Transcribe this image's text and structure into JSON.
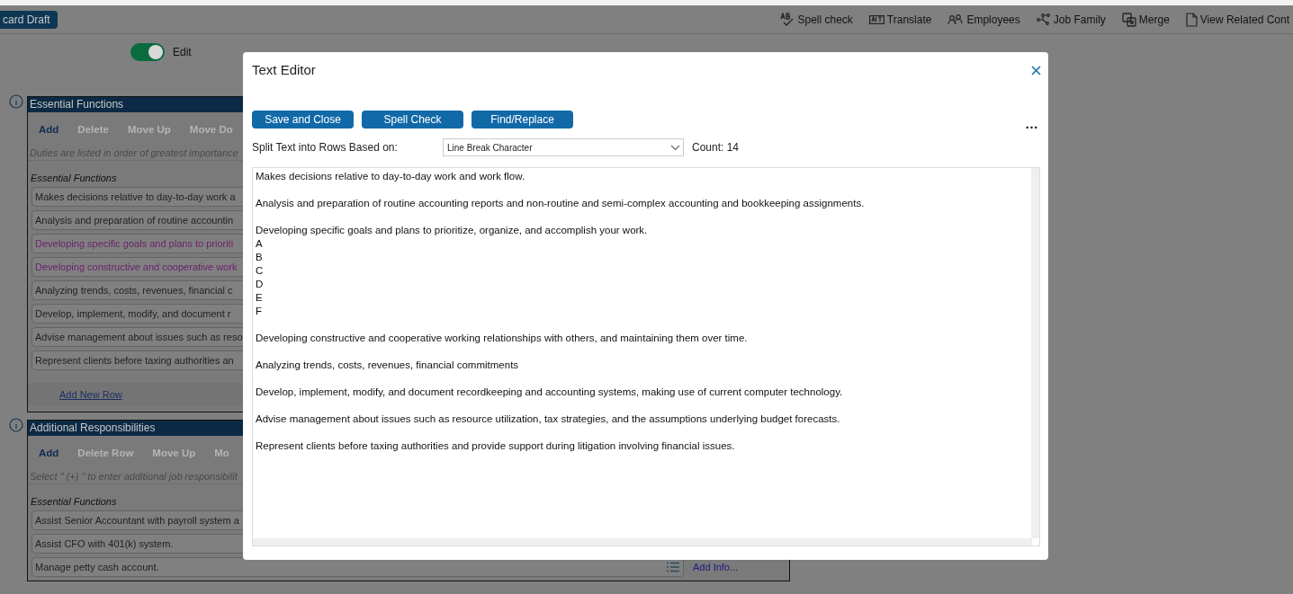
{
  "header": {
    "draft_button": "card Draft",
    "toolbar": [
      {
        "kind": "spell",
        "label": "Spell check"
      },
      {
        "kind": "translate",
        "label": "Translate"
      },
      {
        "kind": "employees",
        "label": "Employees"
      },
      {
        "kind": "family",
        "label": "Job Family"
      },
      {
        "kind": "merge",
        "label": "Merge"
      },
      {
        "kind": "document",
        "label": "View Related Cont"
      }
    ]
  },
  "edit_toggle": {
    "label": "Edit",
    "on": true
  },
  "sections": [
    {
      "title": "Essential Functions",
      "actions": [
        {
          "label": "Add",
          "disabled": false
        },
        {
          "label": "Delete",
          "disabled": true
        },
        {
          "label": "Move Up",
          "disabled": true
        },
        {
          "label": "Move Do",
          "disabled": true
        }
      ],
      "hint": "Duties are listed in order of greatest importance",
      "list_label": "Essential Functions",
      "rows": [
        {
          "text": "Makes decisions relative to day-to-day work a",
          "color": "#1f1f1f"
        },
        {
          "text": "Analysis and preparation of routine accountin",
          "color": "#1f1f1f"
        },
        {
          "text": "Developing specific goals and plans to prioriti",
          "color": "#6b1f6b"
        },
        {
          "text": "Developing constructive and cooperative work",
          "color": "#6b1f6b"
        },
        {
          "text": "Analyzing trends, costs, revenues, financial c",
          "color": "#1f1f1f"
        },
        {
          "text": "Develop, implement, modify, and document r",
          "color": "#1f1f1f"
        },
        {
          "text": "Advise management about issues such as reso",
          "color": "#1f1f1f"
        },
        {
          "text": "Represent clients before taxing authorities an",
          "color": "#1f1f1f"
        }
      ],
      "footer_link": "Add New Row"
    },
    {
      "title": "Additional Responsibilities",
      "actions": [
        {
          "label": "Add",
          "disabled": false
        },
        {
          "label": "Delete Row",
          "disabled": true
        },
        {
          "label": "Move Up",
          "disabled": true
        },
        {
          "label": "Mo",
          "disabled": true
        }
      ],
      "hint": "Select \" (+) \" to enter additional job responsibilit",
      "list_label": "Essential Functions",
      "rows": [
        {
          "text": "Assist Senior Accountant with payroll system a",
          "color": "#1f1f1f"
        },
        {
          "text": "Assist CFO with 401(k) system.",
          "color": "#1f1f1f"
        },
        {
          "text": "Manage petty cash account.",
          "color": "#1f1f1f",
          "info_link": "Add Info..."
        }
      ]
    }
  ],
  "dialog": {
    "title": "Text Editor",
    "buttons": [
      "Save and Close",
      "Spell Check",
      "Find/Replace"
    ],
    "more_button": "…",
    "split_label": "Split Text into Rows Based on:",
    "split_value": "Line Break Character",
    "count": "Count: 14",
    "text": "Makes decisions relative to day-to-day work and work flow.\n\nAnalysis and preparation of routine accounting reports and non-routine and semi-complex accounting and bookkeeping assignments.\n\nDeveloping specific goals and plans to prioritize, organize, and accomplish your work.\nA\nB\nC\nD\nE\nF\n\nDeveloping constructive and cooperative working relationships with others, and maintaining them over time.\n\nAnalyzing trends, costs, revenues, financial commitments\n\nDevelop, implement, modify, and document recordkeeping and accounting systems, making use of current computer technology.\n\nAdvise management about issues such as resource utilization, tax strategies, and the assumptions underlying budget forecasts.\n\nRepresent clients before taxing authorities and provide support during litigation involving financial issues."
  }
}
